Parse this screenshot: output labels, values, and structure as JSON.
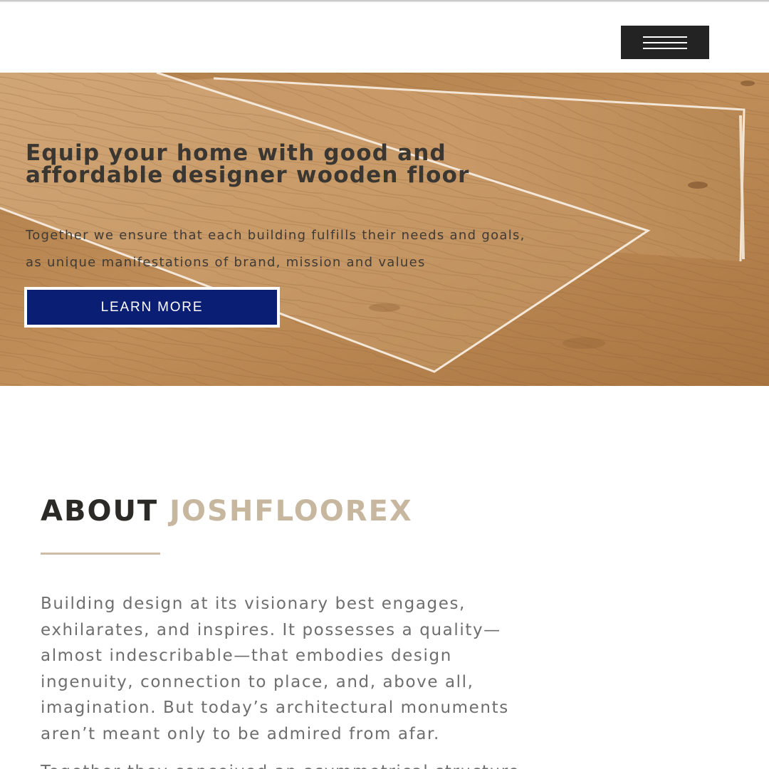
{
  "header": {
    "menu_icon": "hamburger-menu-icon",
    "menu_button_color": "#232323"
  },
  "hero": {
    "background_image": "wooden-floor-planks",
    "title_line_1": "Equip your home with good and",
    "title_line_2": "affordable designer wooden floor",
    "subtitle_line_1": "Together we ensure that each building fulfills their needs and goals,",
    "subtitle_line_2": "as unique manifestations of brand, mission and values",
    "cta_label": "LEARN MORE",
    "cta_color": "#0a1e74"
  },
  "about": {
    "heading_prefix": "ABOUT",
    "heading_brand": "JOSHFLOOREX",
    "brand_color": "#c8b79f",
    "paragraph_lines": [
      "Building design at its visionary best engages,",
      "exhilarates, and inspires. It possesses a quality—",
      "almost indescribable—that embodies design",
      "ingenuity, connection to place, and, above all,",
      "imagination. But today’s architectural monuments",
      "aren’t meant only to be admired from afar."
    ],
    "paragraph_2_partial": "Together they conceived an asymmetrical structure"
  }
}
